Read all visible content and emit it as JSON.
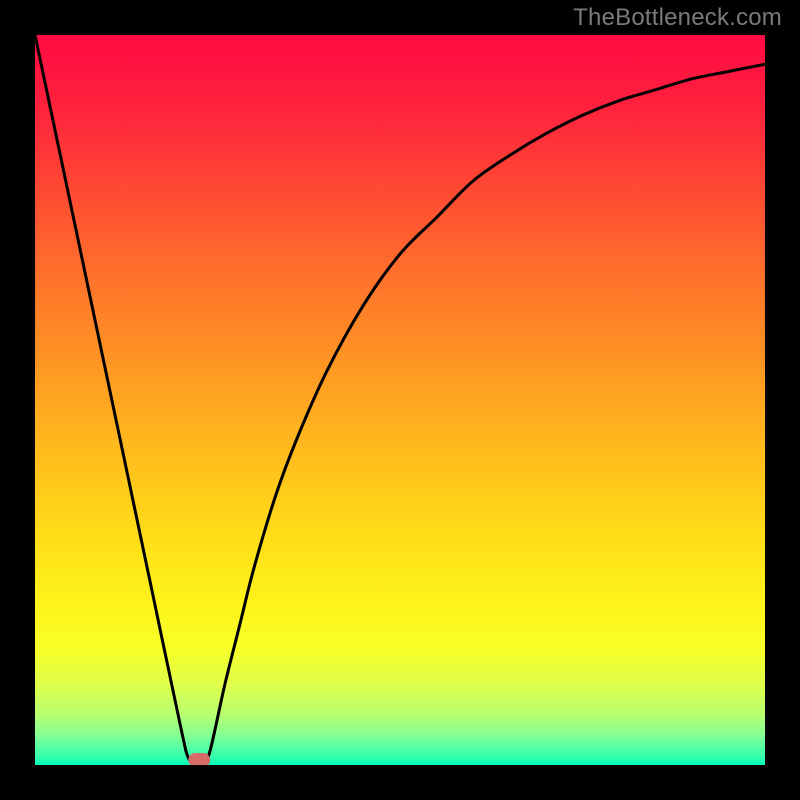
{
  "watermark": "TheBottleneck.com",
  "chart_data": {
    "type": "line",
    "title": "",
    "xlabel": "",
    "ylabel": "",
    "xlim": [
      0,
      100
    ],
    "ylim": [
      0,
      100
    ],
    "legend": false,
    "grid": false,
    "series": [
      {
        "name": "bottleneck-curve",
        "x": [
          0,
          4,
          8,
          12,
          16,
          20,
          21,
          22,
          23,
          24,
          26,
          28,
          30,
          33,
          36,
          40,
          45,
          50,
          55,
          60,
          65,
          70,
          75,
          80,
          85,
          90,
          95,
          100
        ],
        "y": [
          100,
          81,
          62,
          43,
          24,
          5,
          1,
          0,
          0,
          2,
          11,
          19,
          27,
          37,
          45,
          54,
          63,
          70,
          75,
          80,
          83.5,
          86.5,
          89,
          91,
          92.5,
          94,
          95,
          96
        ]
      }
    ],
    "markers": [
      {
        "name": "optimal-capsule",
        "x_range_pct": [
          21,
          24
        ],
        "y_pct": 0,
        "color": "#d96a6a"
      }
    ],
    "background_gradient": {
      "direction": "top-to-bottom",
      "stops": [
        {
          "pos": 0.0,
          "color": "#ff0b42"
        },
        {
          "pos": 0.2,
          "color": "#ff4534"
        },
        {
          "pos": 0.44,
          "color": "#ff9324"
        },
        {
          "pos": 0.68,
          "color": "#ffdb18"
        },
        {
          "pos": 0.84,
          "color": "#f8ff28"
        },
        {
          "pos": 0.96,
          "color": "#82ff94"
        },
        {
          "pos": 1.0,
          "color": "#00ffbd"
        }
      ]
    }
  }
}
